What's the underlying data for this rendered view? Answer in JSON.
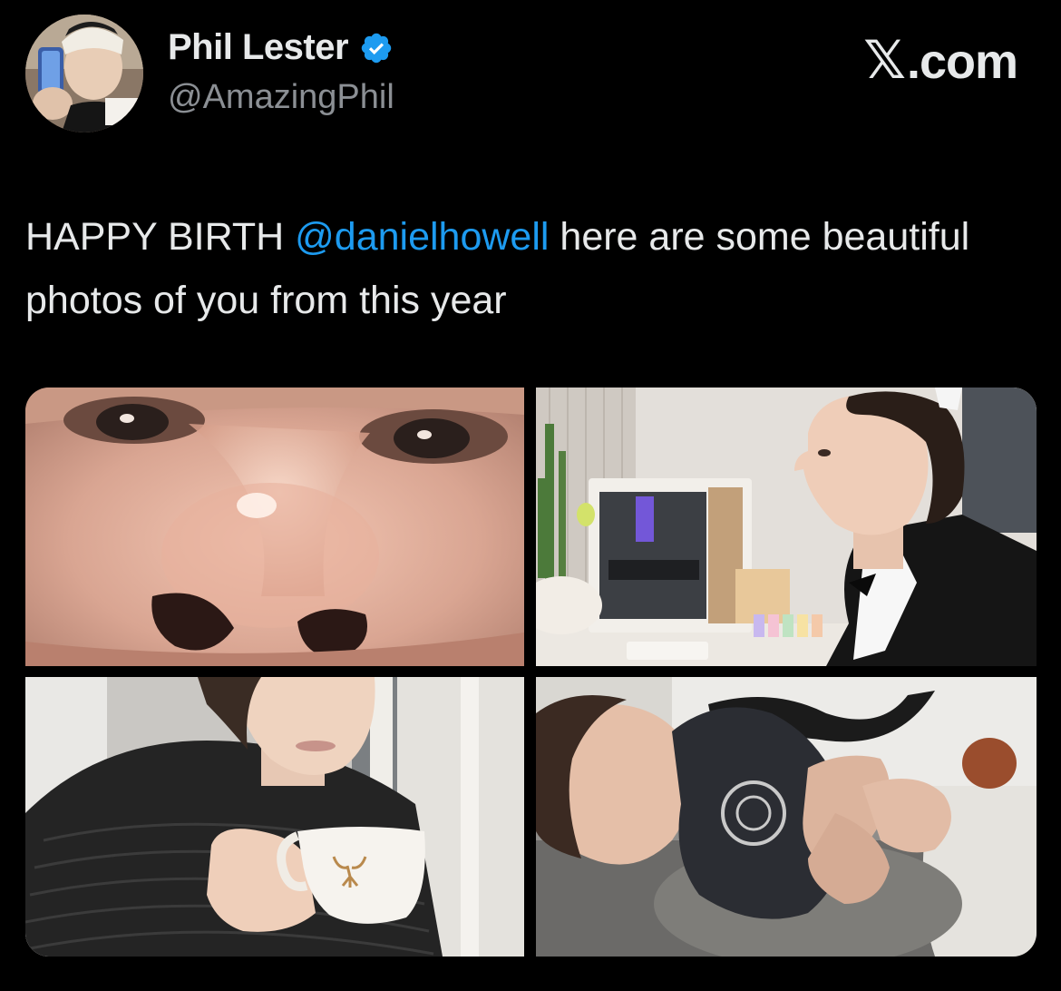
{
  "author": {
    "display_name": "Phil Lester",
    "handle": "@AmazingPhil",
    "verified_icon": "verified-badge-icon",
    "avatar_icon": "profile-avatar"
  },
  "brand": {
    "x_glyph": "𝕏",
    "domain": ".com"
  },
  "tweet": {
    "text_before": "HAPPY BIRTH ",
    "mention": "@danielhowell",
    "text_after": " here are some beautiful photos of you from this year"
  },
  "media": {
    "photos": [
      {
        "name": "photo-closeup-nose"
      },
      {
        "name": "photo-desk-profile"
      },
      {
        "name": "photo-drinking-cup"
      },
      {
        "name": "photo-curled-on-floor"
      }
    ]
  },
  "colors": {
    "background": "#000000",
    "text": "#e7e9ea",
    "secondary_text": "#8b8f94",
    "link": "#1d9bf0",
    "verified": "#1d9bf0"
  }
}
